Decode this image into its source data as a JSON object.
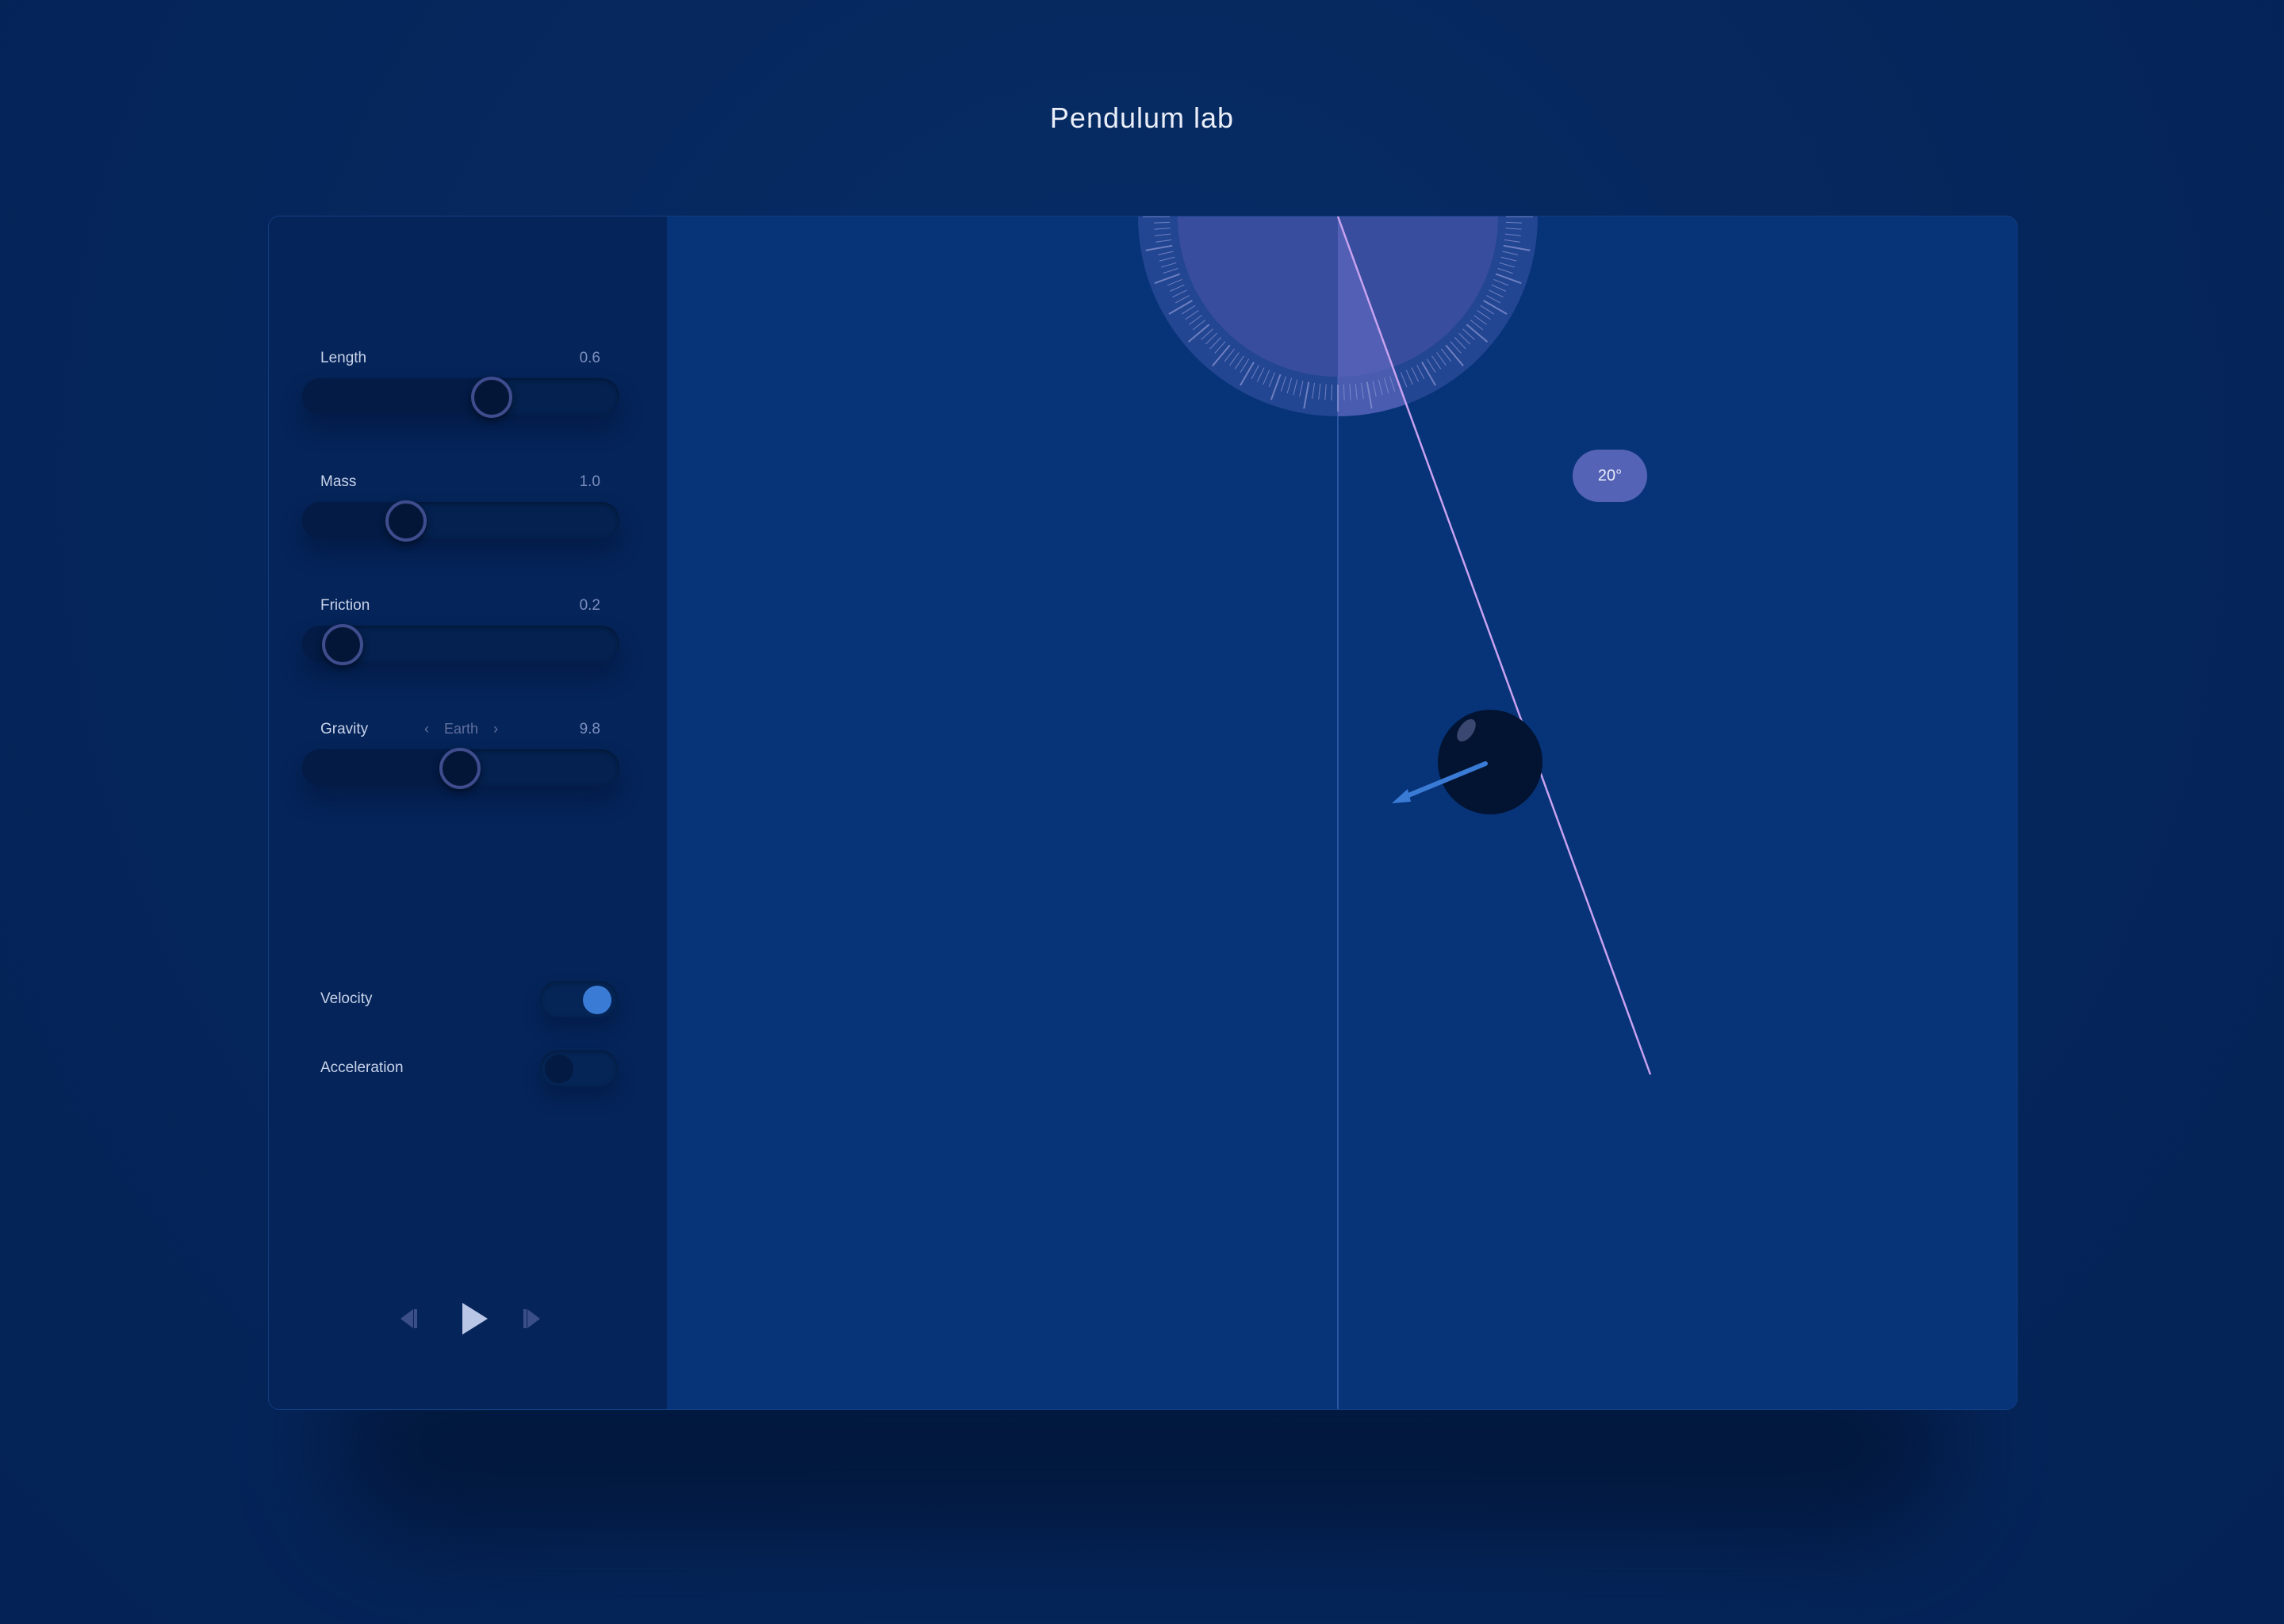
{
  "title": "Pendulum lab",
  "controls": {
    "length": {
      "label": "Length",
      "value": "0.6",
      "fraction": 0.6
    },
    "mass": {
      "label": "Mass",
      "value": "1.0",
      "fraction": 0.33
    },
    "friction": {
      "label": "Friction",
      "value": "0.2",
      "fraction": 0.13
    },
    "gravity": {
      "label": "Gravity",
      "value": "9.8",
      "fraction": 0.5,
      "preset": "Earth",
      "prev_icon": "‹",
      "next_icon": "›"
    }
  },
  "toggles": {
    "velocity": {
      "label": "Velocity",
      "on": true
    },
    "acceleration": {
      "label": "Acceleration",
      "on": false
    }
  },
  "transport": {
    "step_back_icon": "step-back-icon",
    "play_icon": "play-icon",
    "step_forward_icon": "step-forward-icon"
  },
  "protractor": {
    "angle_label": "20°",
    "angle_deg": 20
  },
  "colors": {
    "accent": "#3a7bd5",
    "string": "#c7a2f0",
    "protractor": "#5b63b8",
    "bob": "#021432"
  }
}
